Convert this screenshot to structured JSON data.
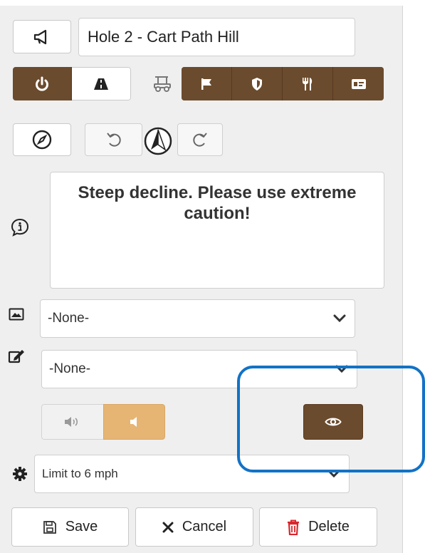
{
  "title_input": {
    "value": "Hole 2 - Cart Path Hill"
  },
  "message": {
    "text": "Steep decline. Please use extreme caution!"
  },
  "image_select": {
    "value": "-None-"
  },
  "edit_select": {
    "value": "-None-"
  },
  "speed_select": {
    "value": "Limit to 6 mph"
  },
  "actions": {
    "save": "Save",
    "cancel": "Cancel",
    "delete": "Delete"
  },
  "colors": {
    "accent": "#6b4b2d",
    "highlight": "#1272c6",
    "orange": "#e6b574",
    "delete_red": "#d9262c"
  },
  "icons": {
    "announce": "megaphone-icon",
    "power": "power-icon",
    "road": "road-icon",
    "cart": "golf-cart-icon",
    "flag": "flag-icon",
    "shield": "shield-icon",
    "food": "utensils-icon",
    "card": "id-card-icon",
    "compass": "compass-icon",
    "undo": "undo-icon",
    "north": "north-arrow-icon",
    "redo": "redo-icon",
    "info": "info-icon",
    "image": "image-icon",
    "edit": "edit-icon",
    "sound_on": "volume-up-icon",
    "sound_off": "volume-off-icon",
    "eye": "eye-icon",
    "gear": "gear-icon"
  }
}
